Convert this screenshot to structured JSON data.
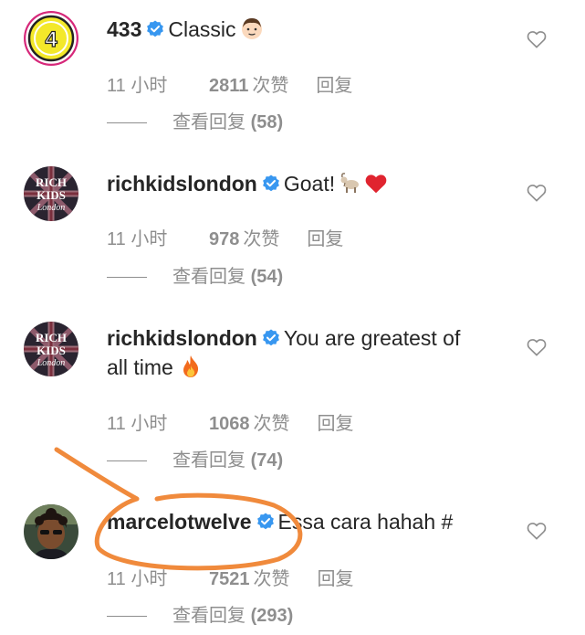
{
  "comments": [
    {
      "username": "433",
      "text": "Classic",
      "time": "11 小时",
      "likes": "2811",
      "likes_suffix": "次赞",
      "reply": "回复",
      "view_replies": "查看回复",
      "reply_count": "(58)",
      "avatar": "433-logo-avatar",
      "emojis": [
        "boy-face-emoji"
      ]
    },
    {
      "username": "richkidslondon",
      "text": "Goat!",
      "time": "11 小时",
      "likes": "978",
      "likes_suffix": "次赞",
      "reply": "回复",
      "view_replies": "查看回复",
      "reply_count": "(54)",
      "avatar": "rich-kids-avatar",
      "emojis": [
        "goat-emoji",
        "red-heart-emoji"
      ]
    },
    {
      "username": "richkidslondon",
      "text_line1": "You are greatest of",
      "text_line2": "all time",
      "time": "11 小时",
      "likes": "1068",
      "likes_suffix": "次赞",
      "reply": "回复",
      "view_replies": "查看回复",
      "reply_count": "(74)",
      "avatar": "rich-kids-avatar",
      "emojis": [
        "fire-emoji"
      ]
    },
    {
      "username": "marcelotwelve",
      "text": "Essa cara hahah #",
      "time": "11 小时",
      "likes": "7521",
      "likes_suffix": "次赞",
      "reply": "回复",
      "view_replies": "查看回复",
      "reply_count": "(293)",
      "avatar": "marcelo-photo-avatar",
      "emojis": []
    }
  ],
  "avatar_text": {
    "433_logo": "4",
    "rich": "RICH",
    "kids": "KIDS",
    "london": "London"
  },
  "colors": {
    "verified_blue": "#3897f0",
    "meta_gray": "#8e8e8e",
    "text": "#262626",
    "annotation_orange": "#f08a3c",
    "logo_ring_pink": "#d6287a",
    "logo_yellow": "#f3e82a"
  }
}
